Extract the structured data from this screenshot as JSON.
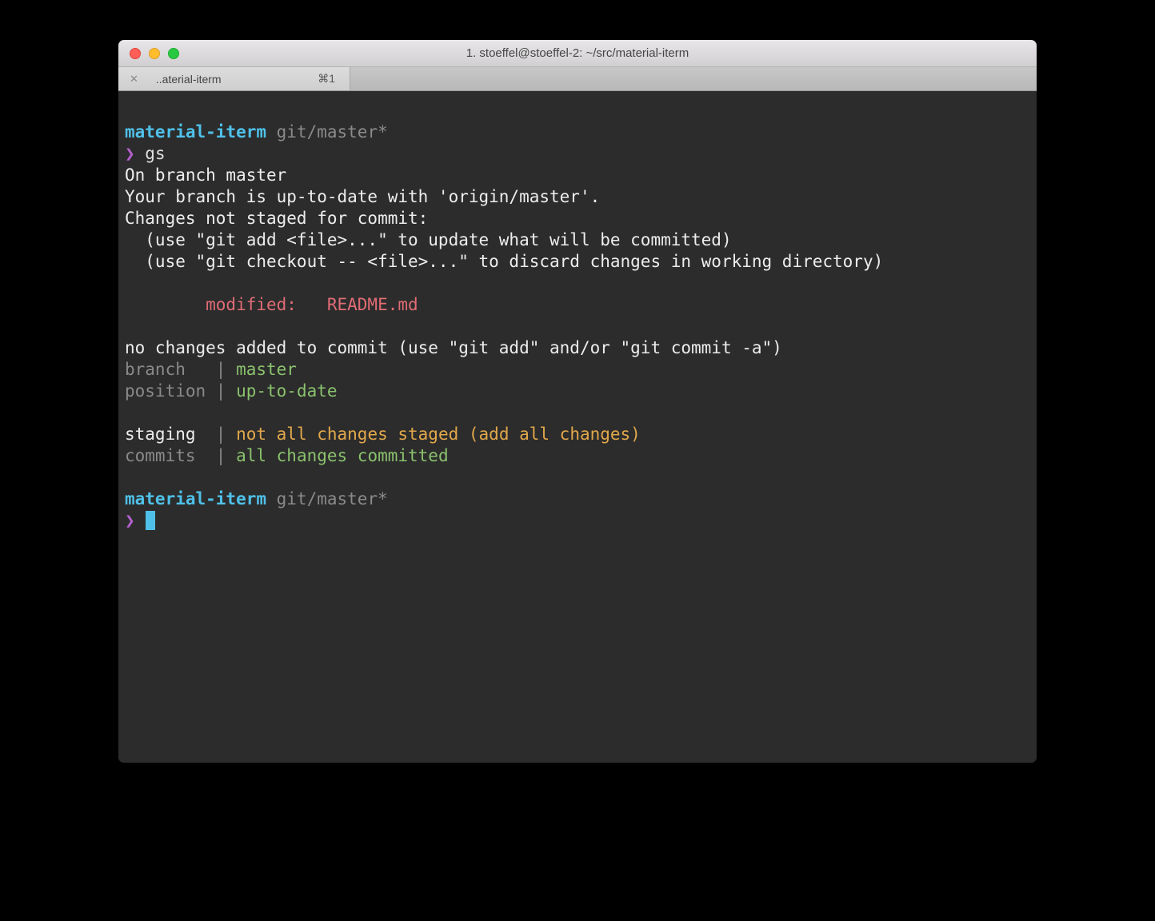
{
  "window": {
    "title": "1. stoeffel@stoeffel-2: ~/src/material-iterm"
  },
  "tab": {
    "close": "✕",
    "label": "..aterial-iterm",
    "shortcut": "⌘1"
  },
  "term": {
    "dir1": "material-iterm",
    "branch1": " git/master*",
    "prompt1": "❯",
    "cmd1": " gs",
    "l1": "On branch master",
    "l2": "Your branch is up-to-date with 'origin/master'.",
    "l3": "Changes not staged for commit:",
    "l4": "  (use \"git add <file>...\" to update what will be committed)",
    "l5": "  (use \"git checkout -- <file>...\" to discard changes in working directory)",
    "l6": "        modified:   README.md",
    "l7": "no changes added to commit (use \"git add\" and/or \"git commit -a\")",
    "kv": {
      "branch_label": "branch  ",
      "branch_pipe": " | ",
      "branch_value": "master",
      "position_label": "position",
      "position_pipe": " | ",
      "position_value": "up-to-date",
      "staging_label": "staging ",
      "staging_pipe": " | ",
      "staging_value": "not all changes staged (add all changes)",
      "commits_label": "commits ",
      "commits_pipe": " | ",
      "commits_value": "all changes committed"
    },
    "dir2": "material-iterm",
    "branch2": " git/master*",
    "prompt2": "❯"
  }
}
